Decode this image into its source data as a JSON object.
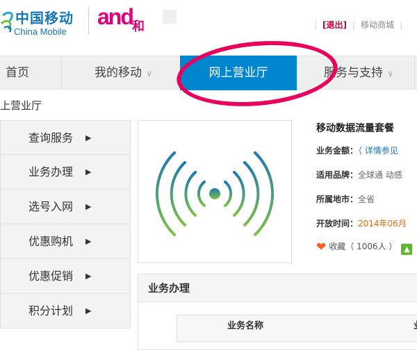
{
  "brand": {
    "cn": "中国移动",
    "en": "China Mobile",
    "and_text": "and",
    "and_he": "和"
  },
  "top_links": {
    "logout": "[退出]",
    "sep": "|",
    "mall": "移动商城"
  },
  "nav": {
    "home": "首页",
    "my_mobile": "我的移动",
    "online_hall": "网上营业厅",
    "service": "服务与支持",
    "chev": "∨"
  },
  "breadcrumb": "上营业厅",
  "sidebar": {
    "arrow": "▶",
    "items": [
      {
        "label": "查询服务"
      },
      {
        "label": "业务办理"
      },
      {
        "label": "选号入网"
      },
      {
        "label": "优惠购机"
      },
      {
        "label": "优惠促销"
      },
      {
        "label": "积分计划"
      }
    ]
  },
  "product": {
    "icon": "wifi-signal-icon",
    "title": "移动数据流量套餐",
    "fee_label": "业务金额：",
    "fee_value": "（ 详情参见",
    "brand_label": "适用品牌：",
    "brand_value": "全球通  动感",
    "region_label": "所属地市：",
    "region_value": "全省",
    "open_label": "开放时间：",
    "open_value": "2014年06月",
    "fav": "收藏（ 1006人 ）"
  },
  "business": {
    "title": "业务办理",
    "col_name": "业务名称",
    "col_other": "业"
  },
  "colors": {
    "brand_blue": "#1677b8",
    "nav_active": "#0086cf",
    "and_pink": "#e2007a",
    "annotation": "#e8005c",
    "date_orange": "#e86a10"
  }
}
